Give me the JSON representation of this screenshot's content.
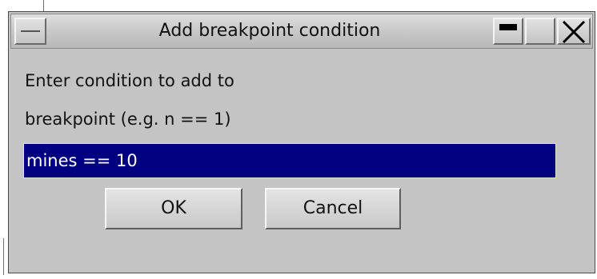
{
  "window": {
    "title": "Add breakpoint condition",
    "controls": {
      "system_menu_icon": "system-menu-icon",
      "minimize_icon": "minimize-icon",
      "maximize_icon": "maximize-icon",
      "close_icon": "close-icon"
    }
  },
  "dialog": {
    "prompt_line_1": "Enter condition to add to",
    "prompt_line_2": "breakpoint (e.g. n == 1)",
    "condition_value": "mines == 10",
    "ok_label": "OK",
    "cancel_label": "Cancel"
  },
  "colors": {
    "background": "#c4c4c4",
    "selection_background": "#000080",
    "selection_text": "#ffffff"
  }
}
